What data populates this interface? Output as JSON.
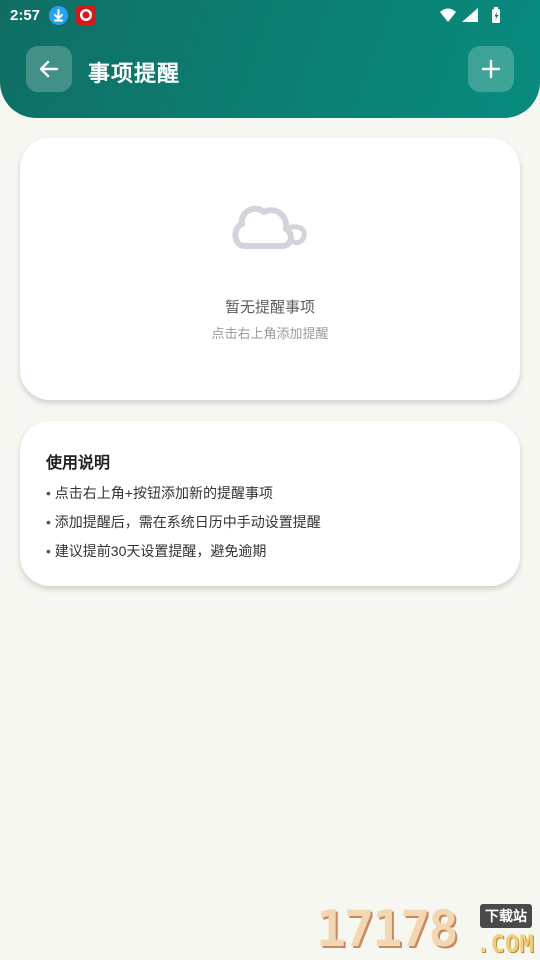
{
  "status_bar": {
    "time": "2:57",
    "icons": [
      "download-icon",
      "app-notification-icon",
      "wifi-icon",
      "signal-icon",
      "battery-icon"
    ]
  },
  "header": {
    "title": "事项提醒",
    "back_icon": "arrow-left-icon",
    "add_icon": "plus-icon",
    "colors": {
      "gradient_start": "#0f6e64",
      "gradient_end": "#088c7e"
    }
  },
  "empty_state": {
    "icon": "cloud-icon",
    "title": "暂无提醒事项",
    "subtitle": "点击右上角添加提醒"
  },
  "instructions": {
    "title": "使用说明",
    "items": [
      "点击右上角+按钮添加新的提醒事项",
      "添加提醒后，需在系统日历中手动设置提醒",
      "建议提前30天设置提醒，避免逾期"
    ]
  },
  "watermark": {
    "number": "17178",
    "tag": "下载站",
    "domain": ".COM"
  }
}
